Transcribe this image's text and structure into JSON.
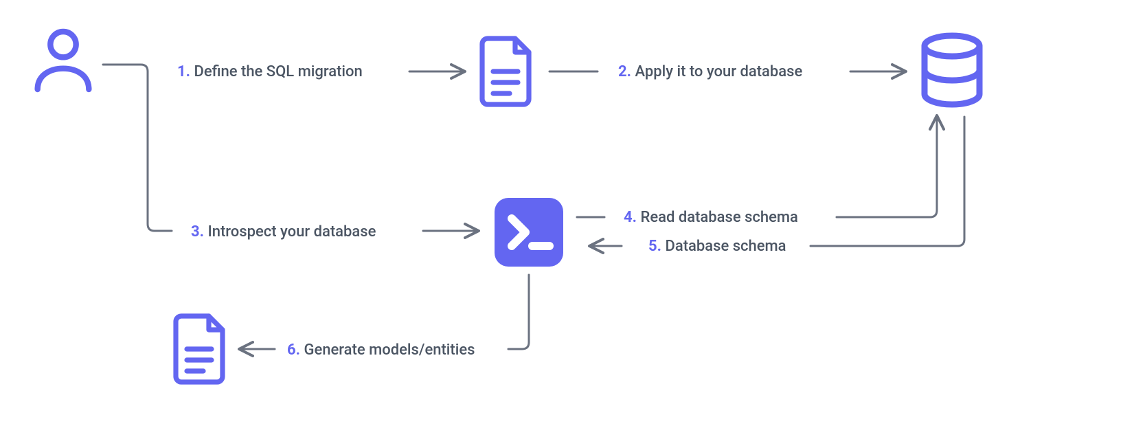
{
  "colors": {
    "accent": "#6366F1",
    "connector": "#6B7280",
    "text": "#4B5563"
  },
  "steps": {
    "s1": {
      "num": "1.",
      "label": "Define the SQL migration"
    },
    "s2": {
      "num": "2.",
      "label": "Apply it to your database"
    },
    "s3": {
      "num": "3.",
      "label": "Introspect your database"
    },
    "s4": {
      "num": "4.",
      "label": "Read database schema"
    },
    "s5": {
      "num": "5.",
      "label": "Database schema"
    },
    "s6": {
      "num": "6.",
      "label": "Generate models/entities"
    }
  },
  "nodes": {
    "user": {
      "icon": "user-icon"
    },
    "file1": {
      "icon": "file-icon"
    },
    "database": {
      "icon": "database-icon"
    },
    "terminal": {
      "icon": "terminal-icon"
    },
    "file2": {
      "icon": "file-icon"
    }
  }
}
